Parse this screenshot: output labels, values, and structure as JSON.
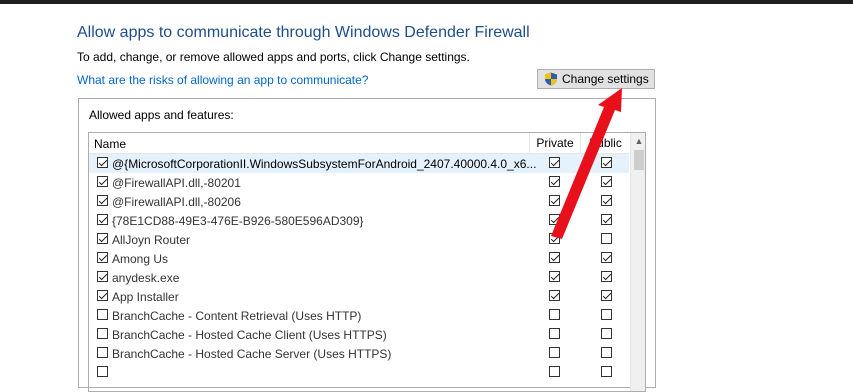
{
  "header": {
    "title": "Allow apps to communicate through Windows Defender Firewall",
    "subtitle": "To add, change, or remove allowed apps and ports, click Change settings.",
    "risk_link": "What are the risks of allowing an app to communicate?",
    "change_settings_label": "Change settings"
  },
  "panel": {
    "label": "Allowed apps and features:",
    "columns": {
      "name": "Name",
      "private": "Private",
      "public": "Public"
    }
  },
  "rows": [
    {
      "name": "@{MicrosoftCorporationII.WindowsSubsystemForAndroid_2407.40000.4.0_x6...",
      "enabled": true,
      "private": true,
      "public": true,
      "selected": true
    },
    {
      "name": "@FirewallAPI.dll,-80201",
      "enabled": true,
      "private": true,
      "public": true
    },
    {
      "name": "@FirewallAPI.dll,-80206",
      "enabled": true,
      "private": true,
      "public": true
    },
    {
      "name": "{78E1CD88-49E3-476E-B926-580E596AD309}",
      "enabled": true,
      "private": true,
      "public": true
    },
    {
      "name": "AllJoyn Router",
      "enabled": true,
      "private": true,
      "public": false
    },
    {
      "name": "Among Us",
      "enabled": true,
      "private": true,
      "public": true
    },
    {
      "name": "anydesk.exe",
      "enabled": true,
      "private": true,
      "public": true
    },
    {
      "name": "App Installer",
      "enabled": true,
      "private": true,
      "public": true
    },
    {
      "name": "BranchCache - Content Retrieval (Uses HTTP)",
      "enabled": false,
      "private": false,
      "public": false
    },
    {
      "name": "BranchCache - Hosted Cache Client (Uses HTTPS)",
      "enabled": false,
      "private": false,
      "public": false
    },
    {
      "name": "BranchCache - Hosted Cache Server (Uses HTTPS)",
      "enabled": false,
      "private": false,
      "public": false
    },
    {
      "name": "",
      "enabled": false,
      "private": false,
      "public": false
    }
  ],
  "colors": {
    "title": "#1e4e8c",
    "link": "#0066cc",
    "arrow": "#e8101a",
    "selected_row": "#e5f1fb"
  },
  "icons": {
    "button": "uac-shield-icon",
    "annotation": "red-arrow-icon"
  }
}
